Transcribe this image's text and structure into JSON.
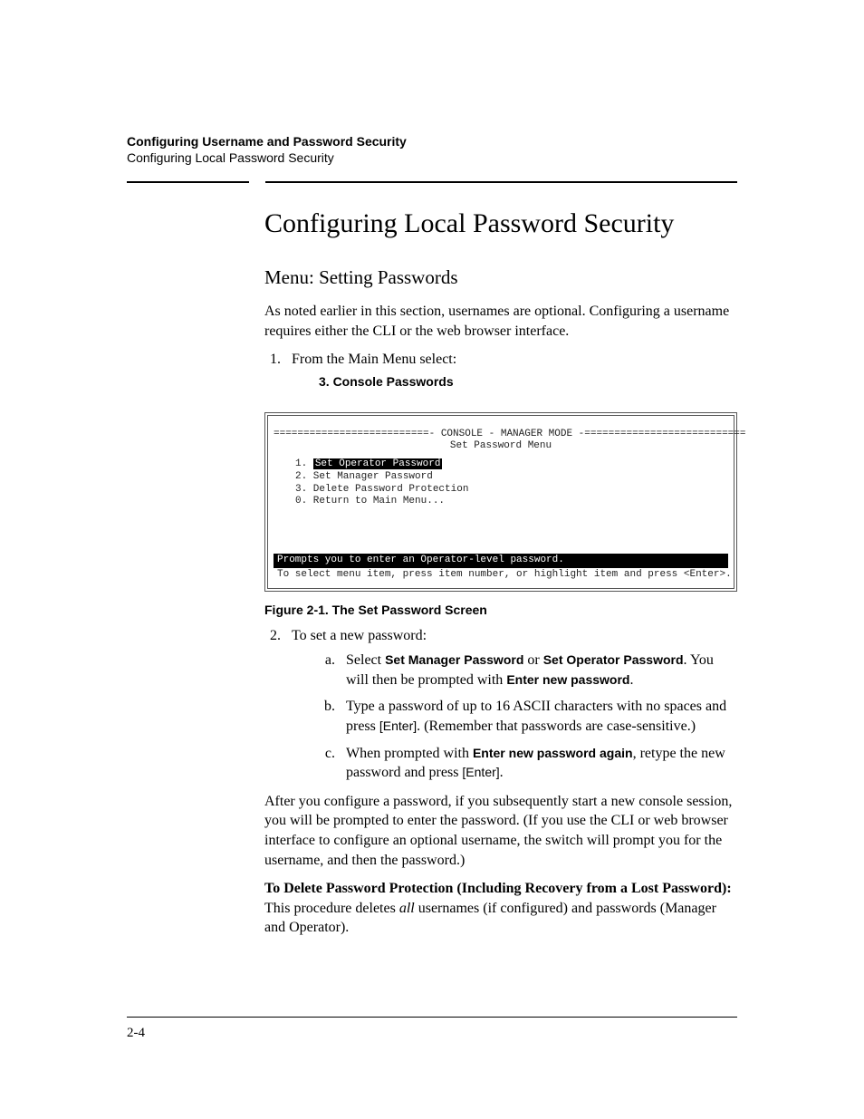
{
  "header": {
    "line1": "Configuring Username and Password Security",
    "line2": "Configuring Local Password Security"
  },
  "title": "Configuring Local Password Security",
  "subtitle": "Menu: Setting Passwords",
  "intro": "As noted earlier in this section, usernames are optional. Configuring a user­name requires either the CLI or the web browser interface.",
  "step1": {
    "text": "From the Main Menu select:",
    "menu_label": "3. Console Passwords"
  },
  "screenshot": {
    "banner_dash": "==========================- CONSOLE - MANAGER MODE -===========================",
    "banner_title": "Set Password Menu",
    "item1_num": "1. ",
    "item1_label": "Set Operator Password",
    "item2": "2. Set Manager Password",
    "item3": "3. Delete Password Protection",
    "item0": "0. Return to Main Menu...",
    "prompt": "Prompts you to enter an Operator-level password.",
    "instruct": "To select menu item, press item number, or highlight item and press <Enter>."
  },
  "fig_caption": "Figure 2-1. The Set Password Screen",
  "step2": {
    "text": "To set a new password:",
    "a_pre": "Select ",
    "a_b1": "Set Manager Password",
    "a_mid": " or ",
    "a_b2": "Set Operator Password",
    "a_post1": ". You will then be prompted with ",
    "a_b3": "Enter new password",
    "a_post2": ".",
    "b_pre": "Type a password of up to 16 ASCII characters with no spaces and press ",
    "b_key": "[Enter]",
    "b_post": ". (Remember that passwords are case-sensitive.)",
    "c_pre": "When prompted with ",
    "c_b1": "Enter new password again",
    "c_mid": ", retype the new pass­word and press ",
    "c_key": "[Enter]",
    "c_post": "."
  },
  "after_para": "After you configure a password, if you subsequently start a new console session, you will be prompted to enter the password. (If you use the CLI or web browser interface to configure an optional username, the switch will prompt you for the username, and then the password.)",
  "delete_para": {
    "lead": "To Delete Password Protection (Including Recovery from a Lost Password):",
    "body_pre": "  This procedure deletes ",
    "body_em": "all",
    "body_post": " usernames (if configured) and pass­words (Manager and Operator)."
  },
  "page_number": "2-4"
}
